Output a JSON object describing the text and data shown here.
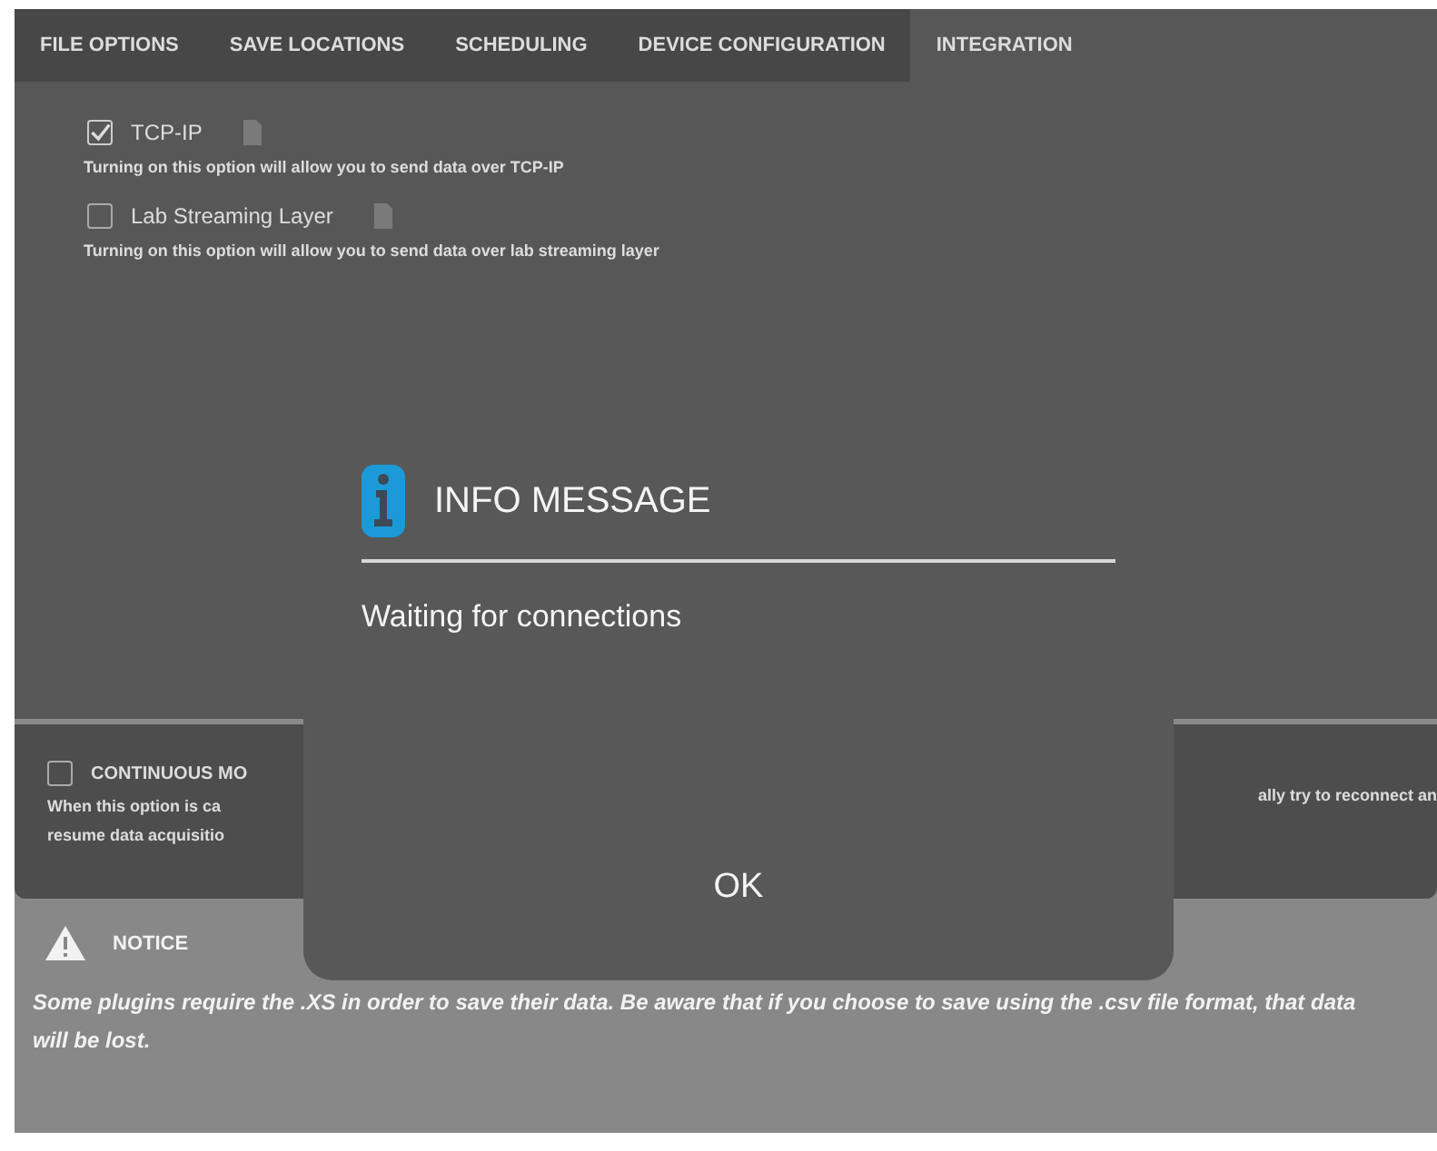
{
  "tabs": [
    {
      "label": "FILE OPTIONS",
      "selected": false
    },
    {
      "label": "SAVE LOCATIONS",
      "selected": false
    },
    {
      "label": "SCHEDULING",
      "selected": false
    },
    {
      "label": "DEVICE CONFIGURATION",
      "selected": false
    },
    {
      "label": "INTEGRATION",
      "selected": true
    }
  ],
  "options": [
    {
      "label": "TCP-IP",
      "checked": true,
      "description": "Turning on this option will allow you to send data over TCP-IP"
    },
    {
      "label": "Lab Streaming Layer",
      "checked": false,
      "description": "Turning on this option will allow you to send data over lab streaming layer"
    }
  ],
  "continuous": {
    "checked": false,
    "label": "CONTINUOUS MO",
    "description_left": [
      "When this option is ca",
      "resume data acquisitio"
    ],
    "description_right": "ally try to reconnect an"
  },
  "notice": {
    "title": "NOTICE",
    "text": "Some plugins require the .XS in order to save their data. Be aware that if you choose to save using the .csv file format, that data will be lost."
  },
  "dialog": {
    "title": "INFO MESSAGE",
    "message": "Waiting for connections",
    "button": "OK"
  }
}
